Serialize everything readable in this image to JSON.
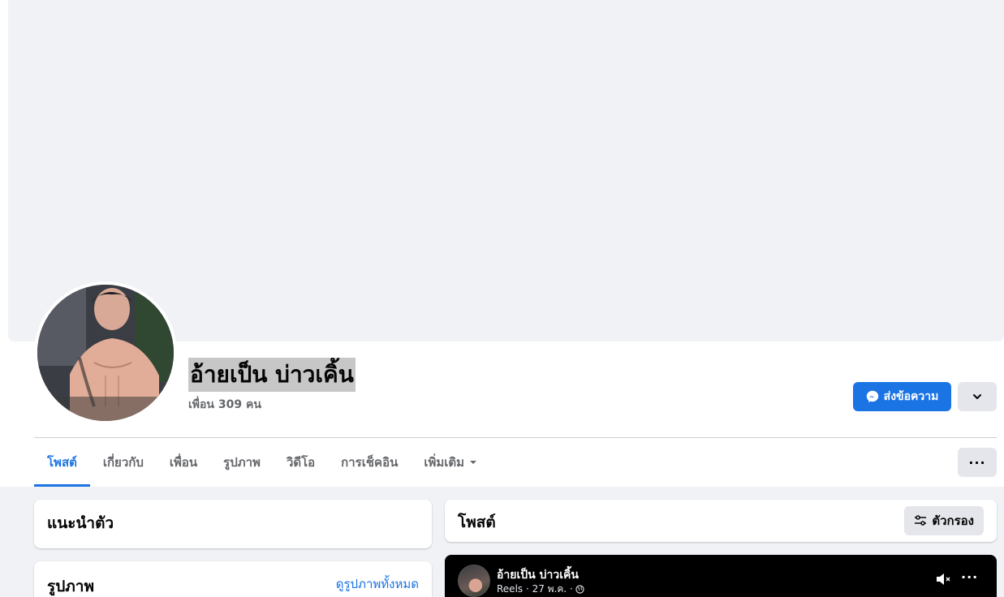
{
  "profile": {
    "name": "อ้ายเป็น บ่าวเคิ้น",
    "friends_text": "เพื่อน 309 คน"
  },
  "actions": {
    "message_label": "ส่งข้อความ",
    "more_label": "···"
  },
  "tabs": [
    {
      "label": "โพสต์",
      "active": true
    },
    {
      "label": "เกี่ยวกับ",
      "active": false
    },
    {
      "label": "เพื่อน",
      "active": false
    },
    {
      "label": "รูปภาพ",
      "active": false
    },
    {
      "label": "วิดีโอ",
      "active": false
    },
    {
      "label": "การเช็คอิน",
      "active": false
    },
    {
      "label": "เพิ่มเติม",
      "active": false
    }
  ],
  "intro": {
    "title": "แนะนำตัว"
  },
  "photos": {
    "title": "รูปภาพ",
    "see_all": "ดูรูปภาพทั้งหมด"
  },
  "posts": {
    "title": "โพสต์",
    "filter_label": "ตัวกรอง"
  },
  "reel": {
    "author": "อ้ายเป็น บ่าวเคิ้น",
    "meta": "Reels · 27 พ.ค. ·",
    "more_label": "···"
  },
  "colors": {
    "accent": "#1b74e4",
    "cover": "#f0f2f5",
    "secondary_button": "#e4e6eb"
  },
  "icons": {
    "messenger": "messenger-icon",
    "chevron": "chevron-down-icon",
    "filter": "filter-icon",
    "mute": "mute-icon",
    "globe": "globe-icon"
  }
}
